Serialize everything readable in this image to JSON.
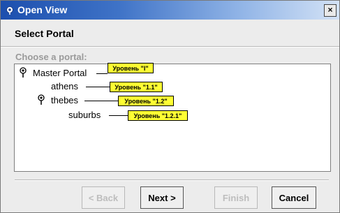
{
  "window": {
    "title": "Open View",
    "close_glyph": "×"
  },
  "header": {
    "heading": "Select Portal"
  },
  "panel": {
    "choose_label": "Choose a portal:"
  },
  "tree": {
    "master": {
      "label": "Master Portal",
      "callout": "Уровень \"I\""
    },
    "athens": {
      "label": "athens",
      "callout": "Уровень \"1.1\""
    },
    "thebes": {
      "label": "thebes",
      "callout": "Уровень \"1.2\""
    },
    "suburbs": {
      "label": "suburbs",
      "callout": "Уровень \"1.2.1\""
    }
  },
  "buttons": {
    "back": "< Back",
    "next": "Next >",
    "finish": "Finish",
    "cancel": "Cancel"
  },
  "colors": {
    "callout_bg": "#ffff33",
    "title_start": "#1c4fae",
    "title_end": "#d3e2f6"
  },
  "icons": [
    "portal-pin-icon",
    "close-icon"
  ]
}
